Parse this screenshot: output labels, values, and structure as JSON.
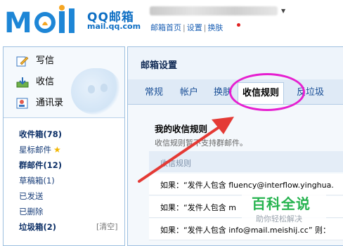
{
  "header": {
    "brand_name": "QQ邮箱",
    "brand_domain": "mail.qq.com",
    "logo_text": "MOil",
    "account_arrow": "▼",
    "links": [
      "邮箱首页",
      "设置",
      "换肤"
    ],
    "link_sep": "|"
  },
  "sidebar": {
    "tools": [
      {
        "label": "写信",
        "icon": "compose-icon"
      },
      {
        "label": "收信",
        "icon": "inbox-download-icon"
      },
      {
        "label": "通讯录",
        "icon": "contacts-icon"
      }
    ],
    "folders": [
      {
        "label": "收件箱(78)",
        "bold": true
      },
      {
        "label": "星标邮件",
        "bold": false,
        "icon": "star-icon"
      },
      {
        "label": "群邮件(12)",
        "bold": true
      },
      {
        "label": "草稿箱(1)",
        "bold": false
      },
      {
        "label": "已发送",
        "bold": false
      },
      {
        "label": "已删除",
        "bold": false
      },
      {
        "label": "垃圾箱(2)",
        "bold": true
      }
    ],
    "clear_trash": "[清空]",
    "star_glyph": "★"
  },
  "main": {
    "title": "邮箱设置",
    "tabs": [
      "常规",
      "帐户",
      "换肤",
      "收信规则",
      "反垃圾"
    ],
    "active_tab": "收信规则",
    "rules_title": "我的收信规则",
    "rules_desc": "收信规则暂不支持群邮件。",
    "rules_header": "收信规则",
    "rules": [
      "如果：“发件人包含 fluency@interflow.yinghua.",
      "如果：“发件人包含 m",
      "如果：“发件人包含 info@mail.meishij.cc”  则："
    ]
  },
  "watermark": {
    "title": "百科全说",
    "subtitle": "助你轻松解决"
  },
  "colors": {
    "accent": "#1e86d6",
    "annotation": "#e61fd0",
    "arrow": "#e43a35",
    "watermark": "#26b34f"
  }
}
